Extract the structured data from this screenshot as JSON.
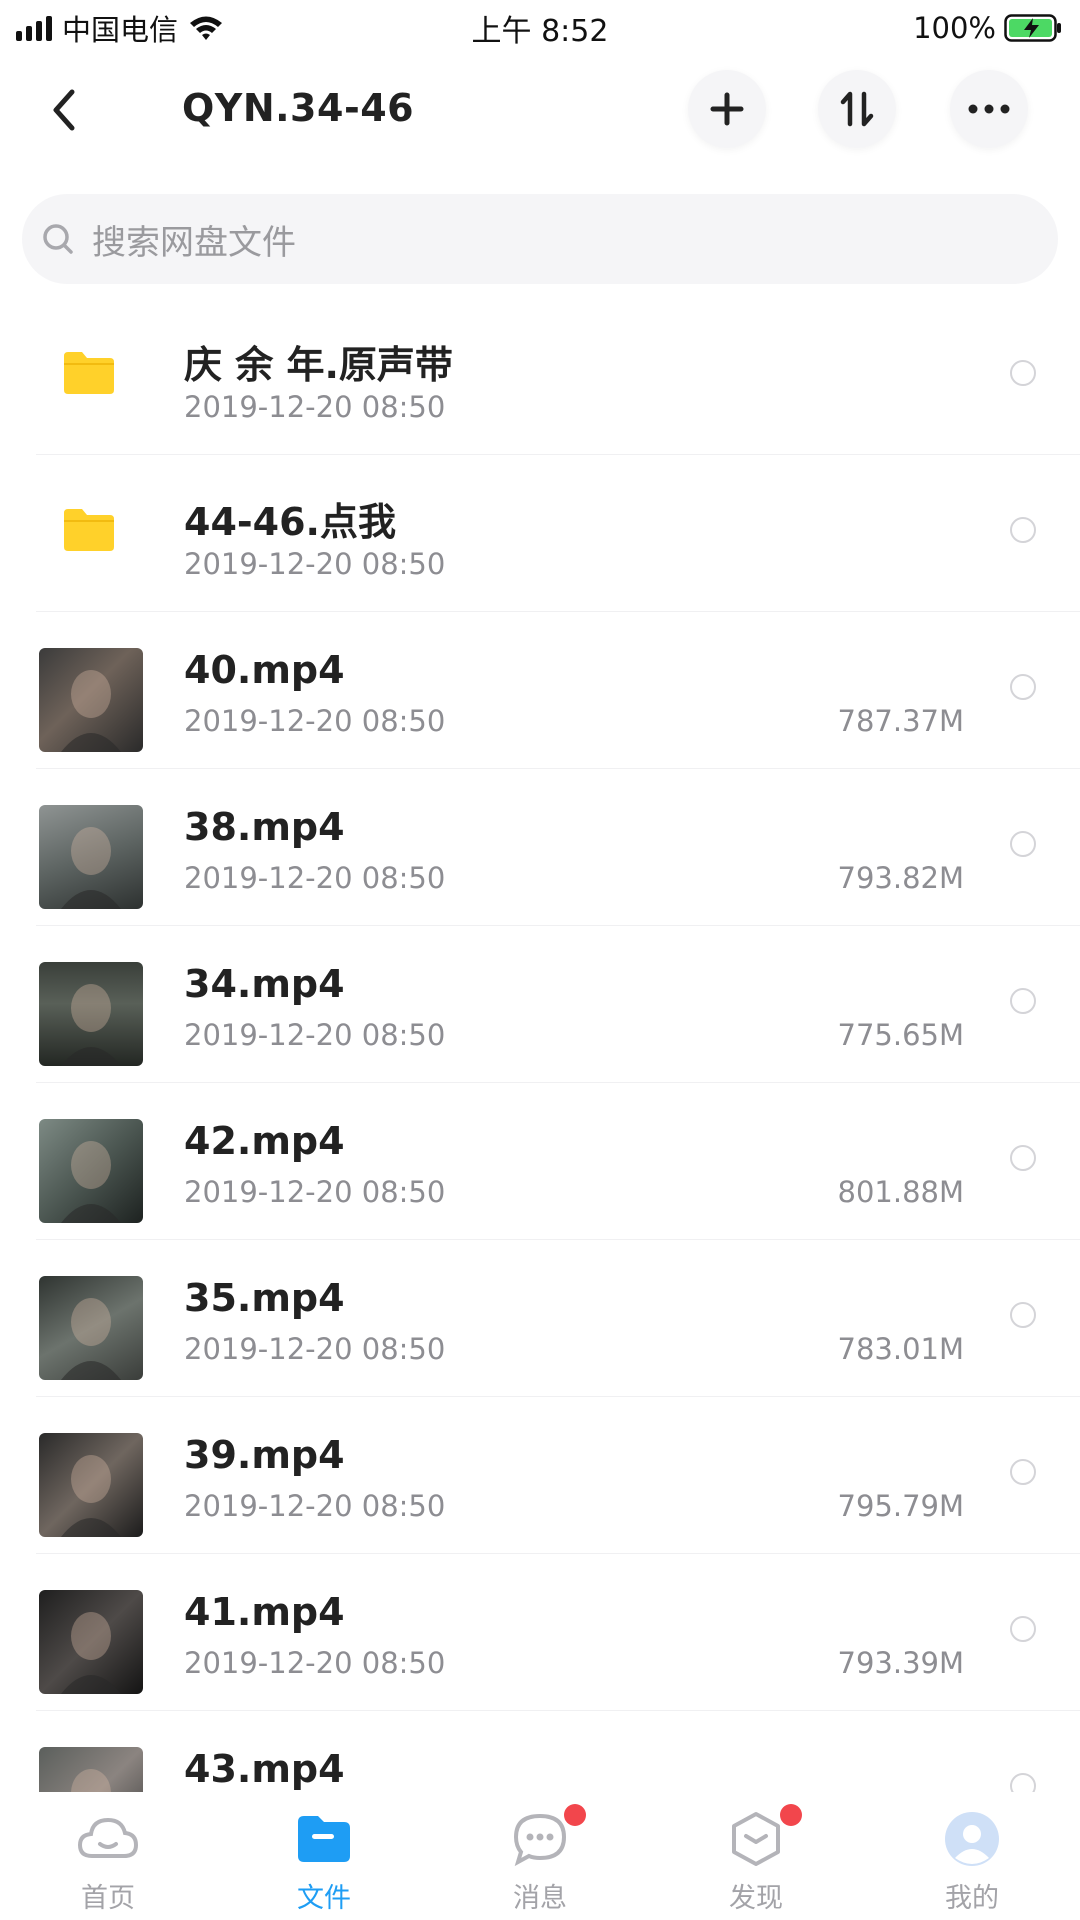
{
  "status_bar": {
    "carrier": "中国电信",
    "time": "上午 8:52",
    "battery": "100%"
  },
  "nav": {
    "title": "QYN.34-46",
    "icons": {
      "back": "chevron-left-icon",
      "add": "plus-icon",
      "sort": "sort-icon",
      "more": "more-icon"
    }
  },
  "search": {
    "placeholder": "搜索网盘文件"
  },
  "files": [
    {
      "name": "庆 余 年.原声带",
      "date": "2019-12-20 08:50",
      "size": "",
      "type": "folder"
    },
    {
      "name": "44-46.点我",
      "date": "2019-12-20 08:50",
      "size": "",
      "type": "folder"
    },
    {
      "name": "40.mp4",
      "date": "2019-12-20 08:50",
      "size": "787.37M",
      "type": "video"
    },
    {
      "name": "38.mp4",
      "date": "2019-12-20 08:50",
      "size": "793.82M",
      "type": "video"
    },
    {
      "name": "34.mp4",
      "date": "2019-12-20 08:50",
      "size": "775.65M",
      "type": "video"
    },
    {
      "name": "42.mp4",
      "date": "2019-12-20 08:50",
      "size": "801.88M",
      "type": "video"
    },
    {
      "name": "35.mp4",
      "date": "2019-12-20 08:50",
      "size": "783.01M",
      "type": "video"
    },
    {
      "name": "39.mp4",
      "date": "2019-12-20 08:50",
      "size": "795.79M",
      "type": "video"
    },
    {
      "name": "41.mp4",
      "date": "2019-12-20 08:50",
      "size": "793.39M",
      "type": "video"
    },
    {
      "name": "43.mp4",
      "date": "",
      "size": "",
      "type": "video"
    }
  ],
  "tabs": [
    {
      "label": "首页",
      "icon": "cloud-icon",
      "active": false,
      "badge": false
    },
    {
      "label": "文件",
      "icon": "folder-icon",
      "active": true,
      "badge": false
    },
    {
      "label": "消息",
      "icon": "chat-icon",
      "active": false,
      "badge": true
    },
    {
      "label": "发现",
      "icon": "discover-icon",
      "active": false,
      "badge": true
    },
    {
      "label": "我的",
      "icon": "avatar-icon",
      "active": false,
      "badge": false
    }
  ],
  "colors": {
    "accent": "#1e9df4",
    "folder": "#ffd12a",
    "badge": "#f2464c",
    "text_secondary": "#8d8d92"
  }
}
